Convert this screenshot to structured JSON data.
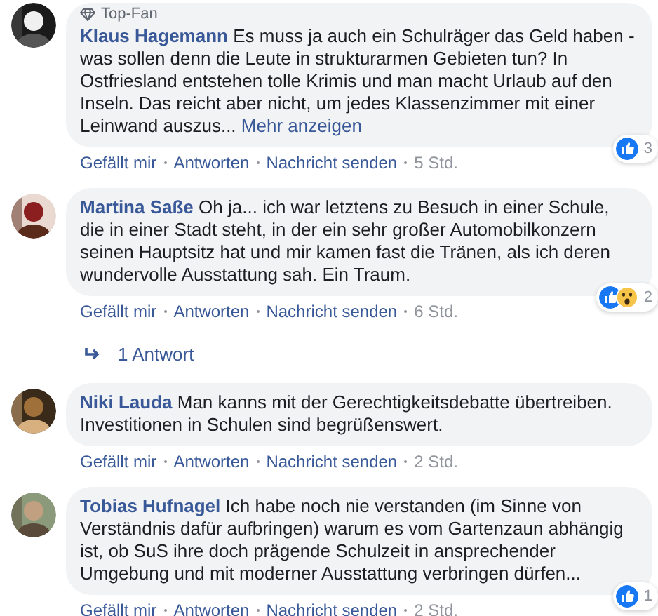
{
  "comments": [
    {
      "badge": "Top-Fan",
      "author": "Klaus Hagemann",
      "text": "Es muss ja auch ein Schulräger das Geld haben - was sollen denn die Leute in strukturarmen Gebieten tun? In Ostfriesland entstehen tolle Krimis und man macht Urlaub auf den Inseln. Das reicht aber nicht, um jedes Klassenzimmer mit einer Leinwand auszus...",
      "more": "Mehr anzeigen",
      "actions": [
        "Gefällt mir",
        "Antworten",
        "Nachricht senden"
      ],
      "time": "5 Std.",
      "reactions": [
        {
          "kind": "like"
        }
      ],
      "reaction_count": "3"
    },
    {
      "author": "Martina Saße",
      "text": "Oh ja... ich war letztens zu Besuch in einer Schule, die in einer Stadt steht, in der ein sehr großer Automobilkonzern seinen Hauptsitz hat und mir kamen fast die Tränen, als ich deren wundervolle Ausstattung sah. Ein Traum.",
      "actions": [
        "Gefällt mir",
        "Antworten",
        "Nachricht senden"
      ],
      "time": "6 Std.",
      "reactions": [
        {
          "kind": "like"
        },
        {
          "kind": "wow"
        }
      ],
      "reaction_count": "2",
      "replies": "1 Antwort"
    },
    {
      "author": "Niki Lauda",
      "text": "Man kanns mit der Gerechtigkeitsdebatte übertreiben. Investitionen in Schulen sind begrüßenswert.",
      "actions": [
        "Gefällt mir",
        "Antworten",
        "Nachricht senden"
      ],
      "time": "2 Std."
    },
    {
      "author": "Tobias Hufnagel",
      "text": "Ich habe noch nie verstanden (im Sinne von Verständnis dafür aufbringen) warum es vom Gartenzaun abhängig ist, ob SuS ihre doch prägende Schulzeit in ansprechender Umgebung und mit moderner Ausstattung verbringen dürfen...",
      "actions": [
        "Gefällt mir",
        "Antworten",
        "Nachricht senden"
      ],
      "time": "2 Std.",
      "reactions": [
        {
          "kind": "like"
        }
      ],
      "reaction_count": "1"
    }
  ]
}
